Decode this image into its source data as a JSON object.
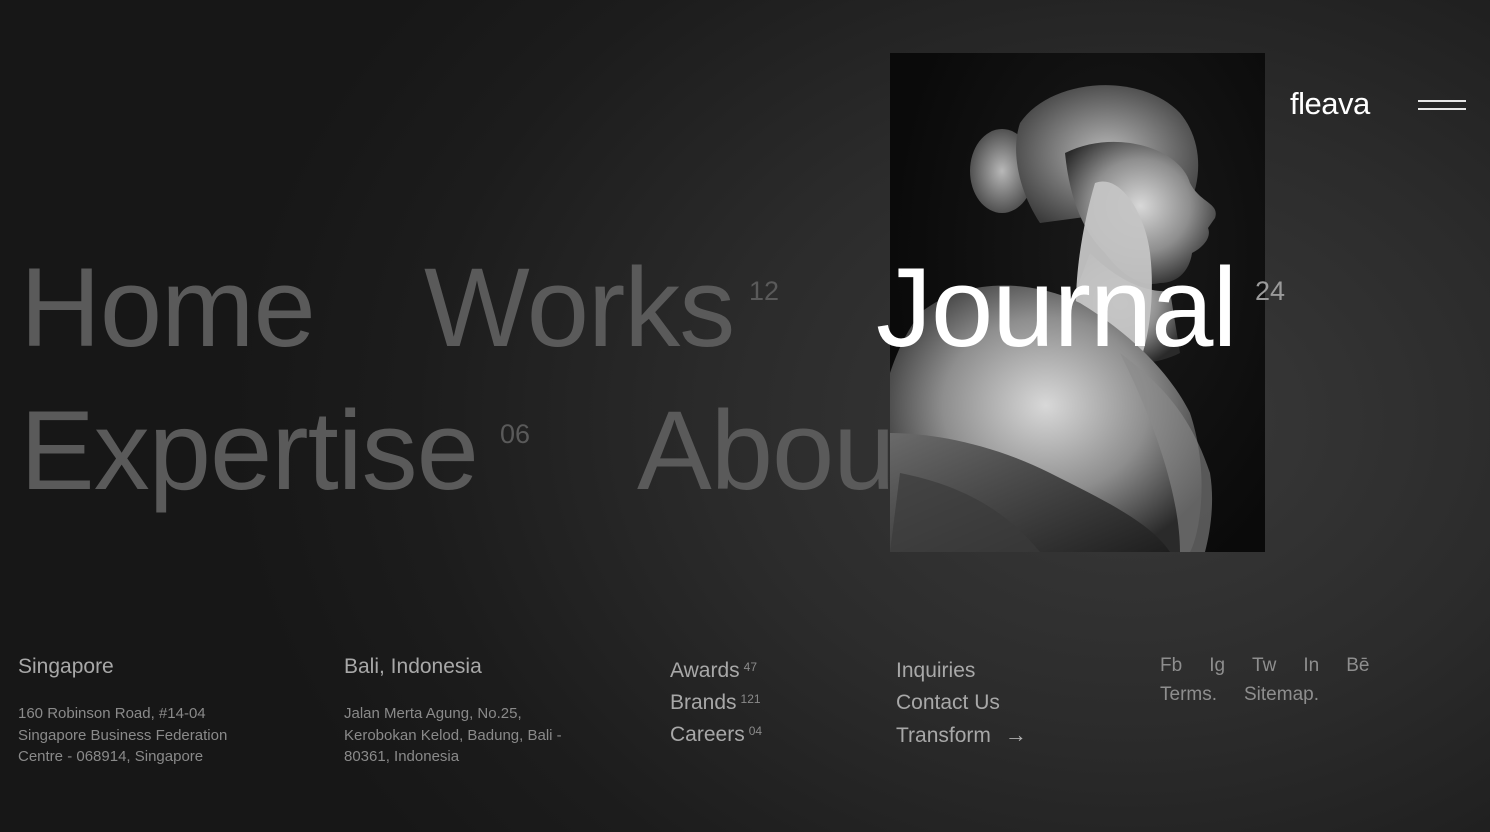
{
  "brand": {
    "logo": "fleava"
  },
  "nav": {
    "home": {
      "label": "Home"
    },
    "works": {
      "label": "Works",
      "count": "12"
    },
    "journal": {
      "label": "Journal",
      "count": "24"
    },
    "expertise": {
      "label": "Expertise",
      "count": "06"
    },
    "about": {
      "label": "About"
    }
  },
  "offices": [
    {
      "city": "Singapore",
      "address": "160 Robinson Road, #14-04 Singapore Business Federation Centre - 068914, Singapore"
    },
    {
      "city": "Bali, Indonesia",
      "address": "Jalan Merta Agung, No.25, Kerobokan Kelod, Badung, Bali - 80361, Indonesia"
    }
  ],
  "stats_links": [
    {
      "label": "Awards",
      "count": "47"
    },
    {
      "label": "Brands",
      "count": "121"
    },
    {
      "label": "Careers",
      "count": "04"
    }
  ],
  "contact_links": [
    {
      "label": "Inquiries"
    },
    {
      "label": "Contact Us"
    },
    {
      "label": "Transform",
      "icon": "arrow-right-icon"
    }
  ],
  "social": {
    "networks": [
      "Fb",
      "Ig",
      "Tw",
      "In",
      "Bē"
    ],
    "legal": [
      "Terms.",
      "Sitemap."
    ]
  },
  "colors": {
    "background": "#1c1c1c",
    "nav_inactive": "#5a5a5a",
    "nav_active": "#ffffff",
    "text_muted": "#a8a8a8"
  }
}
